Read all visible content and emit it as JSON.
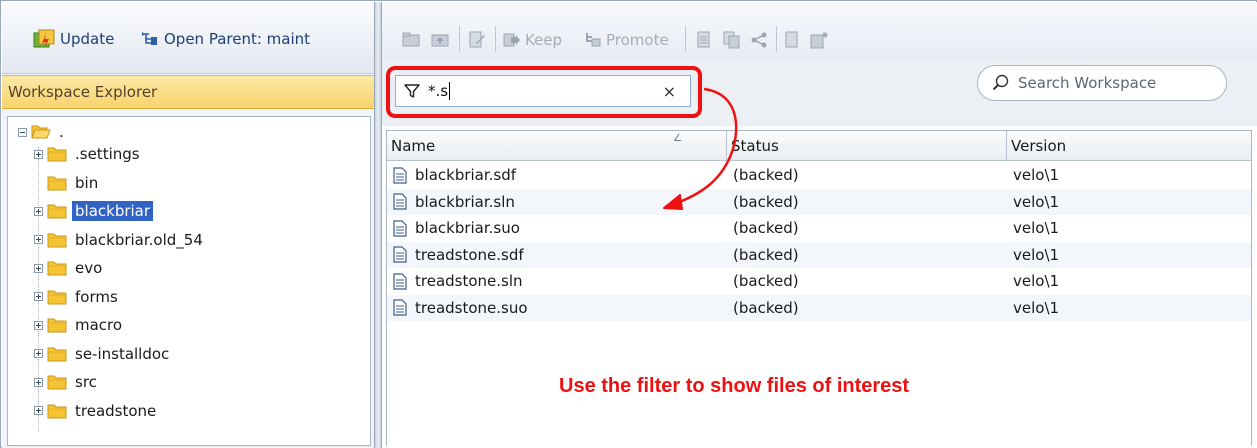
{
  "left_toolbar": {
    "update_label": "Update",
    "open_parent_label": "Open Parent: maint"
  },
  "explorer": {
    "title": "Workspace Explorer",
    "root_label": ".",
    "items": [
      {
        "label": ".settings",
        "expandable": true,
        "selected": false
      },
      {
        "label": "bin",
        "expandable": false,
        "selected": false
      },
      {
        "label": "blackbriar",
        "expandable": true,
        "selected": true
      },
      {
        "label": "blackbriar.old_54",
        "expandable": true,
        "selected": false
      },
      {
        "label": "evo",
        "expandable": true,
        "selected": false
      },
      {
        "label": "forms",
        "expandable": true,
        "selected": false
      },
      {
        "label": "macro",
        "expandable": true,
        "selected": false
      },
      {
        "label": "se-installdoc",
        "expandable": true,
        "selected": false
      },
      {
        "label": "src",
        "expandable": true,
        "selected": false
      },
      {
        "label": "treadstone",
        "expandable": true,
        "selected": false
      }
    ]
  },
  "right_toolbar": {
    "keep_label": "Keep",
    "promote_label": "Promote"
  },
  "filter": {
    "value": "*.s"
  },
  "search": {
    "placeholder": "Search Workspace"
  },
  "table": {
    "columns": [
      "Name",
      "Status",
      "Version"
    ],
    "rows": [
      {
        "name": "blackbriar.sdf",
        "status": "(backed)",
        "version": "velo\\1"
      },
      {
        "name": "blackbriar.sln",
        "status": "(backed)",
        "version": "velo\\1"
      },
      {
        "name": "blackbriar.suo",
        "status": "(backed)",
        "version": "velo\\1"
      },
      {
        "name": "treadstone.sdf",
        "status": "(backed)",
        "version": "velo\\1"
      },
      {
        "name": "treadstone.sln",
        "status": "(backed)",
        "version": "velo\\1"
      },
      {
        "name": "treadstone.suo",
        "status": "(backed)",
        "version": "velo\\1"
      }
    ]
  },
  "annotation": {
    "text": "Use the filter to show files of interest",
    "color": "#ee1111"
  },
  "colors": {
    "selection": "#3163c5",
    "explorer_header": "#f8d46c",
    "folder": "#f5c433"
  }
}
